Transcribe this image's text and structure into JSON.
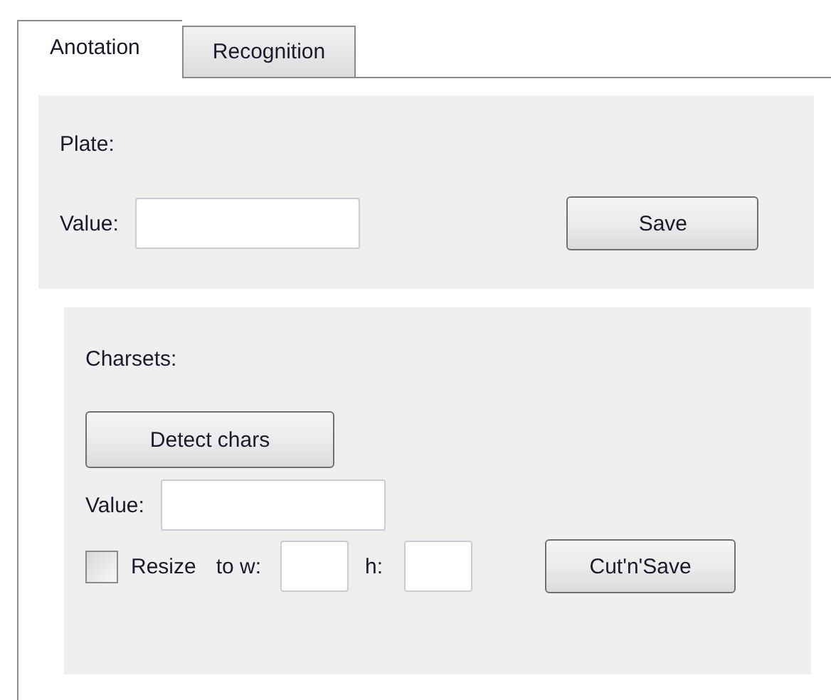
{
  "tabs": [
    {
      "label": "Anotation",
      "selected": true
    },
    {
      "label": "Recognition",
      "selected": false
    }
  ],
  "plate": {
    "title": "Plate:",
    "value_label": "Value:",
    "save_button": "Save"
  },
  "charsets": {
    "title": "Charsets:",
    "detect_button": "Detect chars",
    "value_label": "Value:",
    "resize": {
      "label": "Resize",
      "checked": false
    },
    "width_label": "to w:",
    "height_label": "h:",
    "cut_button": "Cut'n'Save"
  }
}
